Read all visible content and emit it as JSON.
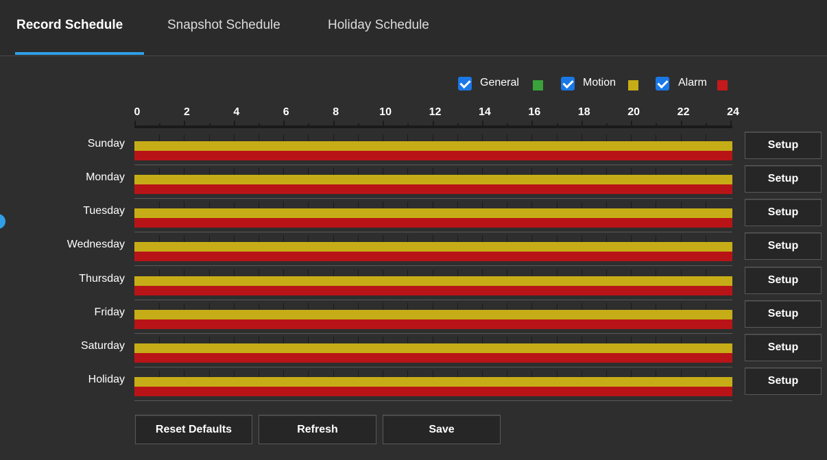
{
  "tabs": [
    {
      "label": "Record Schedule",
      "active": true
    },
    {
      "label": "Snapshot Schedule",
      "active": false
    },
    {
      "label": "Holiday Schedule",
      "active": false
    }
  ],
  "legend": [
    {
      "label": "General",
      "checked": true,
      "color": "#3aa23a"
    },
    {
      "label": "Motion",
      "checked": true,
      "color": "#c6ad17"
    },
    {
      "label": "Alarm",
      "checked": true,
      "color": "#c41a1c"
    }
  ],
  "axis_labels": [
    "0",
    "2",
    "4",
    "6",
    "8",
    "10",
    "12",
    "14",
    "16",
    "18",
    "20",
    "22",
    "24"
  ],
  "days": [
    {
      "label": "Sunday",
      "setup": "Setup"
    },
    {
      "label": "Monday",
      "setup": "Setup"
    },
    {
      "label": "Tuesday",
      "setup": "Setup"
    },
    {
      "label": "Wednesday",
      "setup": "Setup"
    },
    {
      "label": "Thursday",
      "setup": "Setup"
    },
    {
      "label": "Friday",
      "setup": "Setup"
    },
    {
      "label": "Saturday",
      "setup": "Setup"
    },
    {
      "label": "Holiday",
      "setup": "Setup"
    }
  ],
  "buttons": {
    "reset": "Reset Defaults",
    "refresh": "Refresh",
    "save": "Save"
  }
}
